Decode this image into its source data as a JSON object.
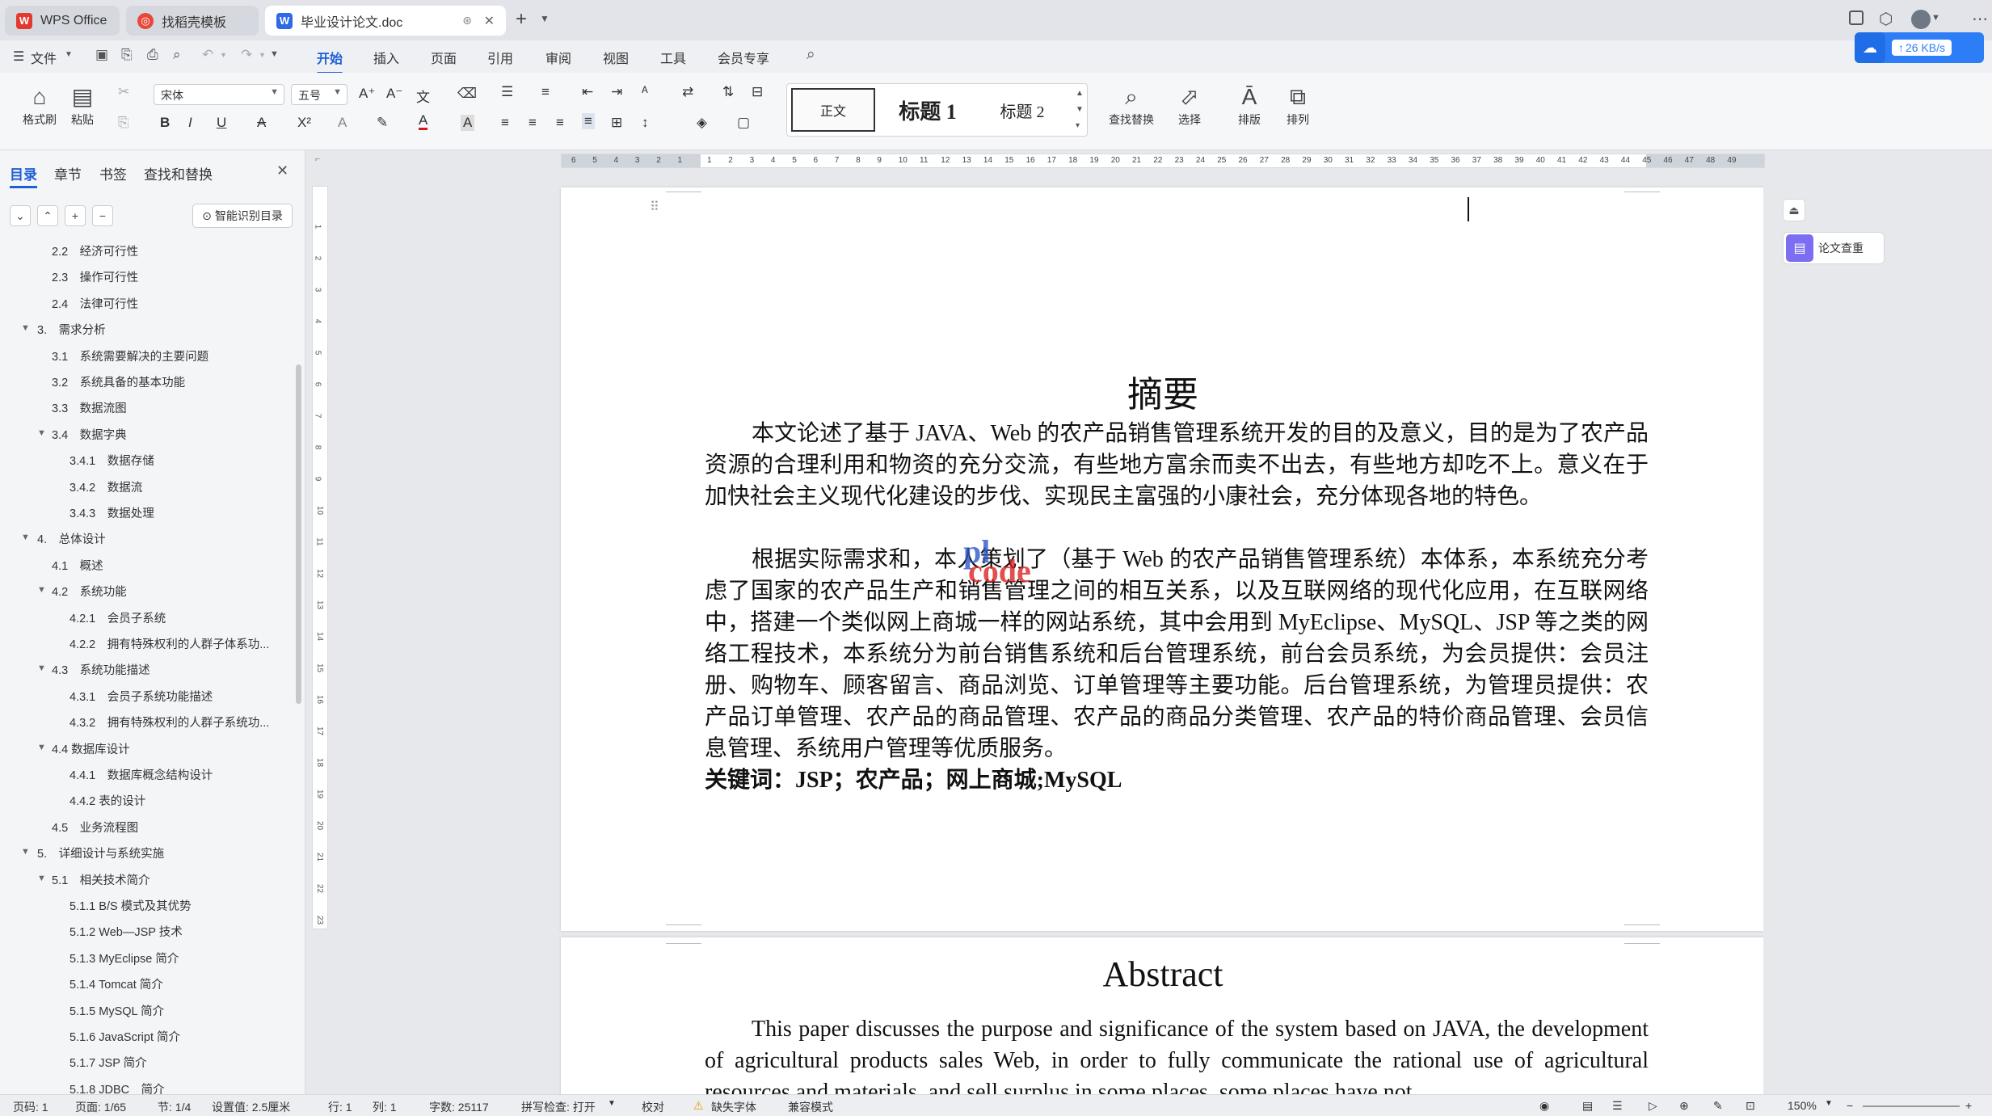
{
  "tabs": [
    {
      "label": "WPS Office",
      "icon": "wps-logo-icon",
      "active": false
    },
    {
      "label": "找稻壳模板",
      "icon": "daoke-icon",
      "active": false
    },
    {
      "label": "毕业设计论文.doc",
      "icon": "word-doc-icon",
      "active": true
    }
  ],
  "menu": {
    "file": "文件",
    "items": [
      "开始",
      "插入",
      "页面",
      "引用",
      "审阅",
      "视图",
      "工具",
      "会员专享"
    ],
    "active": "开始"
  },
  "ribbon": {
    "format_painter": "格式刷",
    "paste": "粘贴",
    "font_name": "宋体",
    "font_size": "五号",
    "styles": [
      "正文",
      "标题 1",
      "标题 2"
    ],
    "find_replace": "查找替换",
    "select": "选择",
    "layout": "排版",
    "arrange": "排列"
  },
  "cloud_speed": "26 KB/s",
  "left_panel": {
    "tabs": [
      "目录",
      "章节",
      "书签",
      "查找和替换"
    ],
    "smart_toc": "智能识别目录",
    "toc": [
      {
        "label": "2.2　经济可行性",
        "level": 2,
        "caret": ""
      },
      {
        "label": "2.3　操作可行性",
        "level": 2,
        "caret": ""
      },
      {
        "label": "2.4　法律可行性",
        "level": 2,
        "caret": ""
      },
      {
        "label": "3.　需求分析",
        "level": 1,
        "caret": "▼"
      },
      {
        "label": "3.1　系统需要解决的主要问题",
        "level": 2,
        "caret": ""
      },
      {
        "label": "3.2　系统具备的基本功能",
        "level": 2,
        "caret": ""
      },
      {
        "label": "3.3　数据流图",
        "level": 2,
        "caret": ""
      },
      {
        "label": "3.4　数据字典",
        "level": 2,
        "caret": "▼"
      },
      {
        "label": "3.4.1　数据存储",
        "level": 3,
        "caret": ""
      },
      {
        "label": "3.4.2　数据流",
        "level": 3,
        "caret": ""
      },
      {
        "label": "3.4.3　数据处理",
        "level": 3,
        "caret": ""
      },
      {
        "label": "4.　总体设计",
        "level": 1,
        "caret": "▼"
      },
      {
        "label": "4.1　概述",
        "level": 2,
        "caret": ""
      },
      {
        "label": "4.2　系统功能",
        "level": 2,
        "caret": "▼"
      },
      {
        "label": "4.2.1　会员子系统",
        "level": 3,
        "caret": ""
      },
      {
        "label": "4.2.2　拥有特殊权利的人群子体系功...",
        "level": 3,
        "caret": ""
      },
      {
        "label": "4.3　系统功能描述",
        "level": 2,
        "caret": "▼"
      },
      {
        "label": "4.3.1　会员子系统功能描述",
        "level": 3,
        "caret": ""
      },
      {
        "label": "4.3.2　拥有特殊权利的人群子系统功...",
        "level": 3,
        "caret": ""
      },
      {
        "label": "4.4 数据库设计",
        "level": 2,
        "caret": "▼"
      },
      {
        "label": "4.4.1　数据库概念结构设计",
        "level": 3,
        "caret": ""
      },
      {
        "label": "4.4.2 表的设计",
        "level": 3,
        "caret": ""
      },
      {
        "label": "4.5　业务流程图",
        "level": 2,
        "caret": ""
      },
      {
        "label": "5.　详细设计与系统实施",
        "level": 1,
        "caret": "▼"
      },
      {
        "label": "5.1　相关技术简介",
        "level": 2,
        "caret": "▼"
      },
      {
        "label": "5.1.1 B/S 模式及其优势",
        "level": 3,
        "caret": ""
      },
      {
        "label": "5.1.2 Web—JSP 技术",
        "level": 3,
        "caret": ""
      },
      {
        "label": "5.1.3 MyEclipse 简介",
        "level": 3,
        "caret": ""
      },
      {
        "label": "5.1.4 Tomcat 简介",
        "level": 3,
        "caret": ""
      },
      {
        "label": "5.1.5 MySQL 简介",
        "level": 3,
        "caret": ""
      },
      {
        "label": "5.1.6 JavaScript 简介",
        "level": 3,
        "caret": ""
      },
      {
        "label": "5.1.7 JSP 简介",
        "level": 3,
        "caret": ""
      },
      {
        "label": "5.1.8 JDBC　简介",
        "level": 3,
        "caret": ""
      }
    ]
  },
  "document": {
    "abstract_title": "摘要",
    "abstract_p1": "本文论述了基于 JAVA、Web 的农产品销售管理系统开发的目的及意义，目的是为了农产品资源的合理利用和物资的充分交流，有些地方富余而卖不出去，有些地方却吃不上。意义在于加快社会主义现代化建设的步伐、实现民主富强的小康社会，充分体现各地的特色。",
    "abstract_p2": "根据实际需求和，本人策划了（基于 Web 的农产品销售管理系统）本体系，本系统充分考虑了国家的农产品生产和销售管理之间的相互关系，以及互联网络的现代化应用，在互联网络中，搭建一个类似网上商城一样的网站系统，其中会用到 MyEclipse、MySQL、JSP 等之类的网络工程技术，本系统分为前台销售系统和后台管理系统，前台会员系统，为会员提供：会员注册、购物车、顾客留言、商品浏览、订单管理等主要功能。后台管理系统，为管理员提供：农产品订单管理、农产品的商品管理、农产品的商品分类管理、农产品的特价商品管理、会员信息管理、系统用户管理等优质服务。",
    "keywords": "关键词：JSP；农产品；网上商城;MySQL",
    "english_title": "Abstract",
    "english_p1": "This paper discusses the purpose and significance of the system based on JAVA, the development of agricultural products sales Web, in order to fully communicate the rational use of agricultural resources and materials, and sell surplus in some places, some places have not.",
    "watermark_top": "pl",
    "watermark_bottom": "code"
  },
  "right_panel": {
    "check_label": "论文查重"
  },
  "status": {
    "page_code": "页码: 1",
    "page": "页面: 1/65",
    "section": "节: 1/4",
    "setting": "设置值: 2.5厘米",
    "row": "行: 1",
    "col": "列: 1",
    "words": "字数: 25117",
    "spell": "拼写检查: 打开",
    "proof": "校对",
    "missing_font": "缺失字体",
    "compat": "兼容模式",
    "zoom": "150%"
  }
}
